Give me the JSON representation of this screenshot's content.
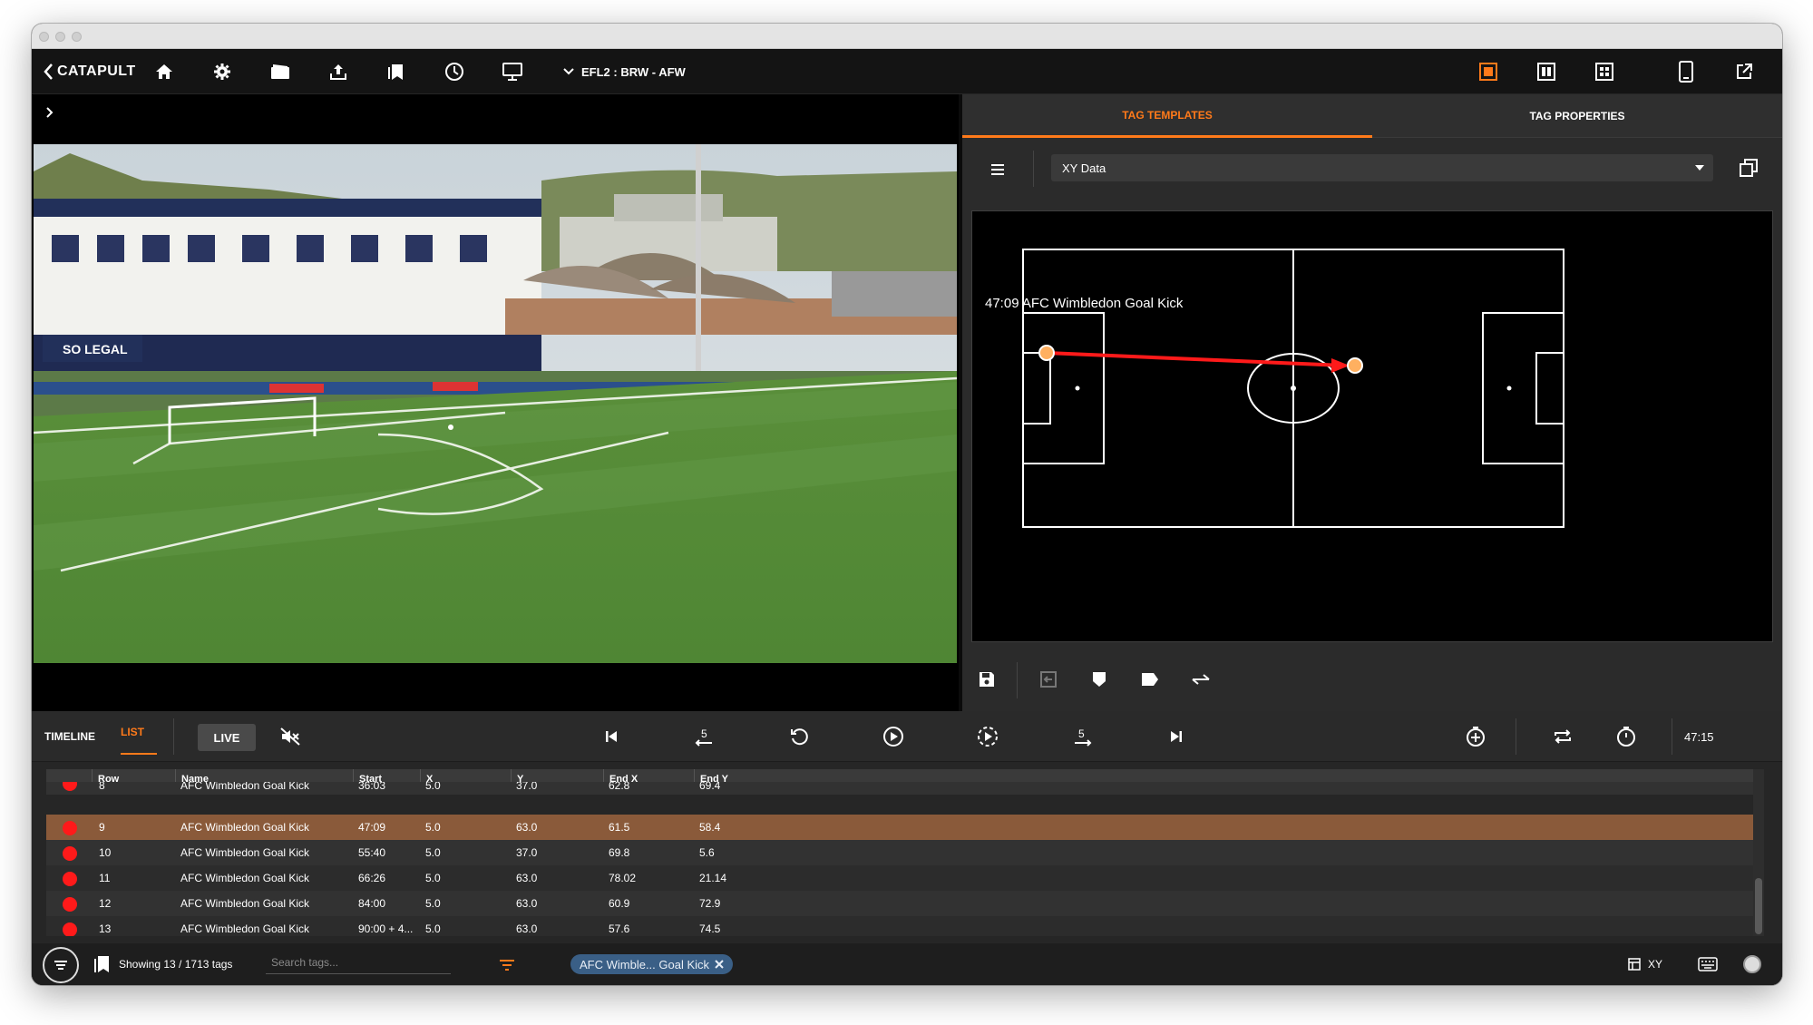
{
  "window": {
    "traffic_lights": [
      "close",
      "minimize",
      "zoom"
    ]
  },
  "toolbar": {
    "logo": "CATAPULT",
    "match_label": "EFL2 : BRW - AFW",
    "icons": [
      "home-icon",
      "gear-icon",
      "video-icon",
      "upload-icon",
      "bookmark-icon",
      "clock-icon",
      "monitor-icon"
    ],
    "layout_icons": [
      "single-view-icon",
      "split-view-icon",
      "grid-view-icon"
    ],
    "right_icons": [
      "tablet-icon",
      "external-link-icon"
    ],
    "accent": "#ff7a1a"
  },
  "right_panel": {
    "tabs": [
      {
        "label": "TAG TEMPLATES",
        "active": true
      },
      {
        "label": "TAG PROPERTIES",
        "active": false
      }
    ],
    "template_select": "XY Data",
    "pitch_event_label": "47:09 AFC Wimbledon Goal Kick",
    "action_icons": [
      "save-icon",
      "import-icon",
      "shield-icon",
      "tag-icon",
      "swap-icon"
    ]
  },
  "controls": {
    "timeline_label": "TIMELINE",
    "list_label": "LIST",
    "live_label": "LIVE",
    "skip_back_label": "5",
    "skip_fwd_label": "5",
    "time": "47:15"
  },
  "table": {
    "headers": [
      "Row",
      "Name",
      "Start",
      "X",
      "Y",
      "End X",
      "End Y"
    ],
    "rows": [
      {
        "row": "8",
        "name": "AFC Wimbledon Goal Kick",
        "start": "36:03",
        "x": "5.0",
        "y": "37.0",
        "endx": "62.8",
        "endy": "69.4",
        "selected": false
      },
      {
        "row": "9",
        "name": "AFC Wimbledon Goal Kick",
        "start": "47:09",
        "x": "5.0",
        "y": "63.0",
        "endx": "61.5",
        "endy": "58.4",
        "selected": true
      },
      {
        "row": "10",
        "name": "AFC Wimbledon Goal Kick",
        "start": "55:40",
        "x": "5.0",
        "y": "37.0",
        "endx": "69.8",
        "endy": "5.6",
        "selected": false
      },
      {
        "row": "11",
        "name": "AFC Wimbledon Goal Kick",
        "start": "66:26",
        "x": "5.0",
        "y": "63.0",
        "endx": "78.02",
        "endy": "21.14",
        "selected": false
      },
      {
        "row": "12",
        "name": "AFC Wimbledon Goal Kick",
        "start": "84:00",
        "x": "5.0",
        "y": "63.0",
        "endx": "60.9",
        "endy": "72.9",
        "selected": false
      },
      {
        "row": "13",
        "name": "AFC Wimbledon Goal Kick",
        "start": "90:00 + 4...",
        "x": "5.0",
        "y": "63.0",
        "endx": "57.6",
        "endy": "74.5",
        "selected": false
      }
    ],
    "selected_color": "#8a5a3a",
    "dot_color": "#ff1a1a"
  },
  "status": {
    "showing": "Showing 13 / 1713 tags",
    "search_placeholder": "Search tags...",
    "filter_chip": "AFC Wimble... Goal Kick",
    "xy_label": "XY"
  }
}
